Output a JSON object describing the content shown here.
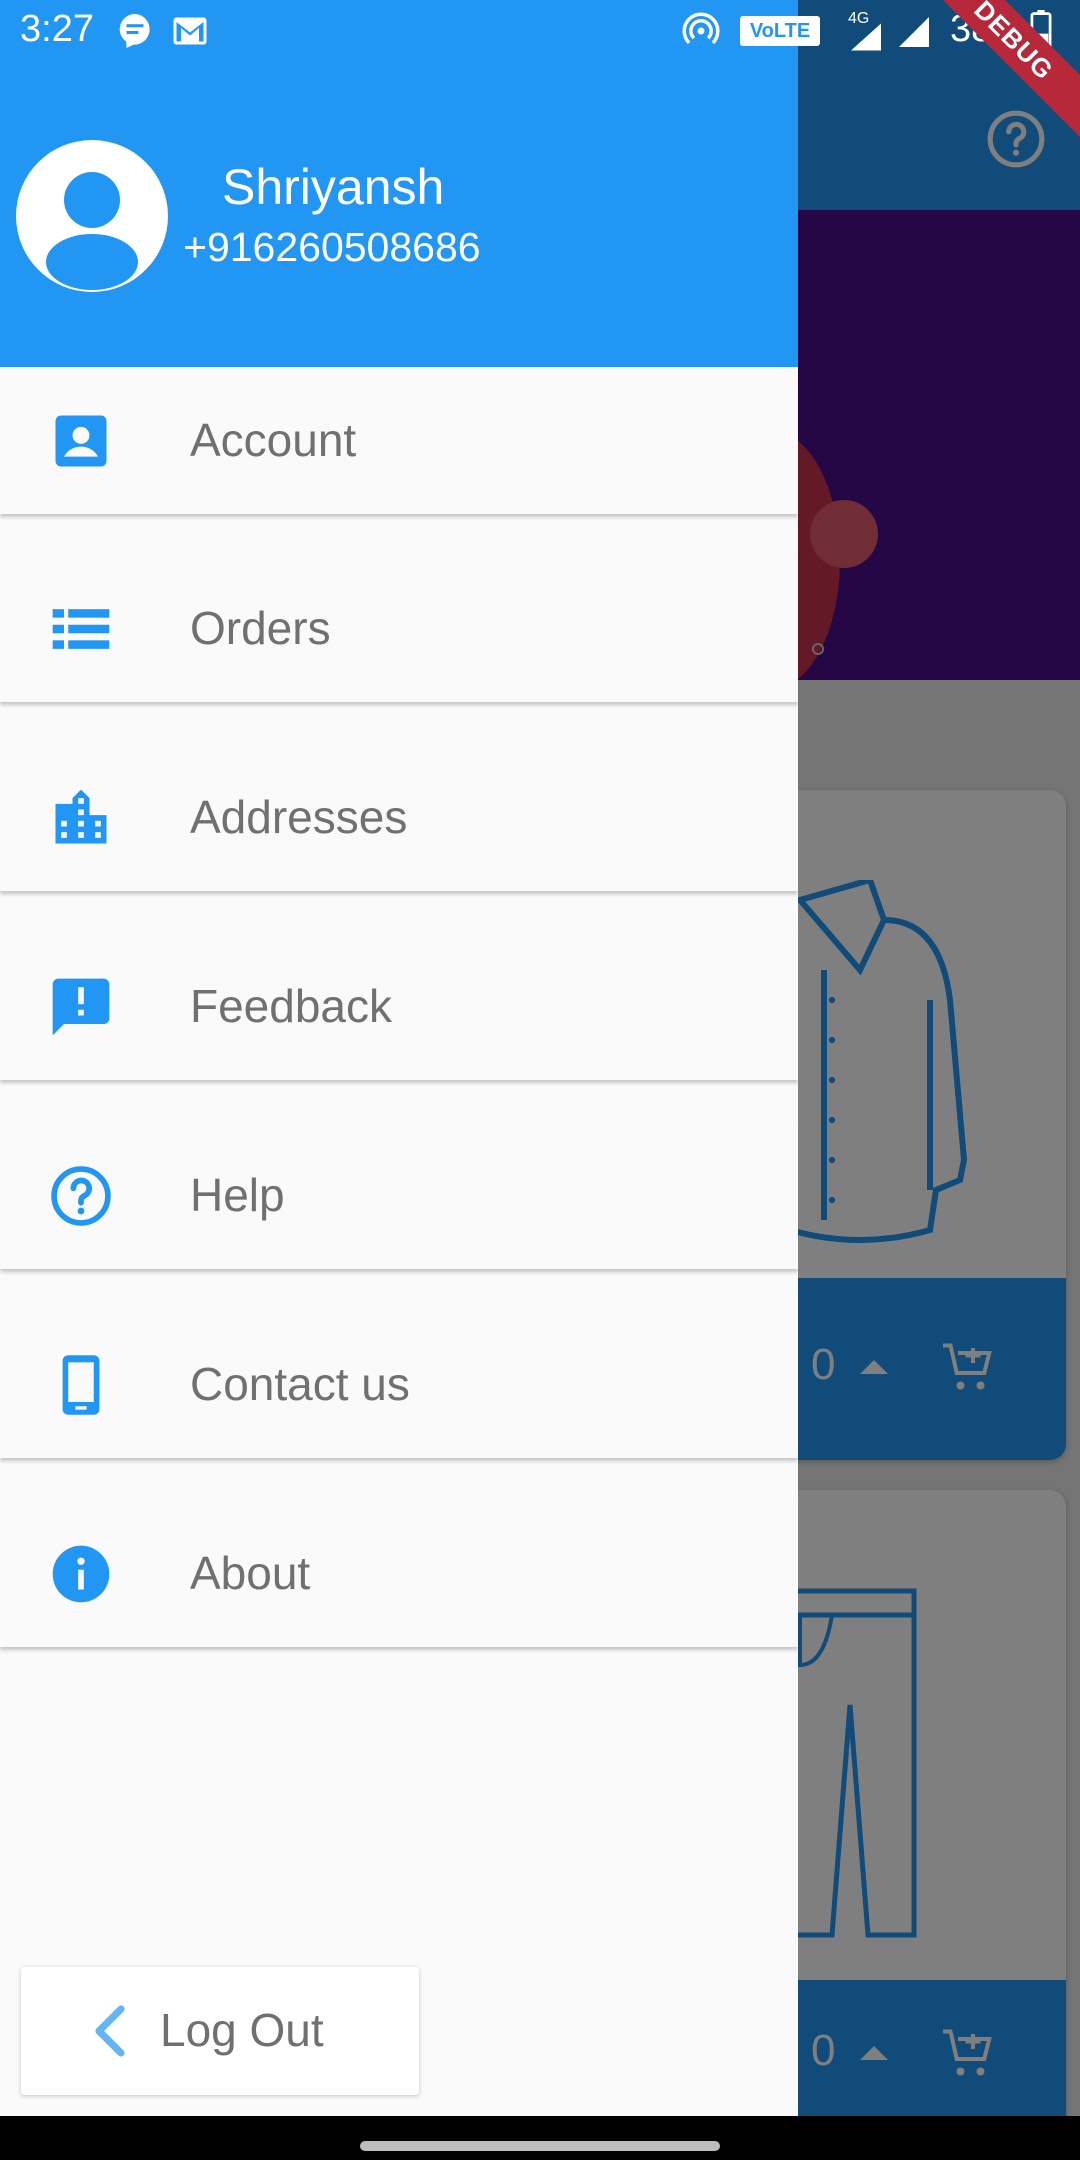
{
  "status_bar": {
    "time": "3:27",
    "battery_text": "38%",
    "network": "4G",
    "volte": "VoLTE",
    "debug_banner": "DEBUG",
    "icons": [
      "chat-notification-icon",
      "gmail-icon",
      "hotspot-icon",
      "volte-icon",
      "signal-icon",
      "signal-icon",
      "battery-icon"
    ]
  },
  "drawer": {
    "user": {
      "name": "Shriyansh",
      "phone": "+916260508686"
    },
    "menu": [
      {
        "label": "Account",
        "icon": "account-box-icon"
      },
      {
        "label": "Orders",
        "icon": "list-icon"
      },
      {
        "label": "Addresses",
        "icon": "location-city-icon"
      },
      {
        "label": "Feedback",
        "icon": "feedback-icon"
      },
      {
        "label": "Help",
        "icon": "help-outline-icon"
      },
      {
        "label": "Contact us",
        "icon": "phone-android-icon"
      },
      {
        "label": "About",
        "icon": "info-icon"
      }
    ],
    "logout_label": "Log Out"
  },
  "background_app": {
    "product_cards": [
      {
        "quantity": "0",
        "image": "shirt-icon"
      },
      {
        "quantity": "0",
        "image": "trousers-icon"
      }
    ]
  },
  "colors": {
    "primary": "#2196f3",
    "drawer_bg": "#fafafa",
    "text_muted": "#707070",
    "banner": "#4a0f8c",
    "debug": "#b7283a"
  }
}
